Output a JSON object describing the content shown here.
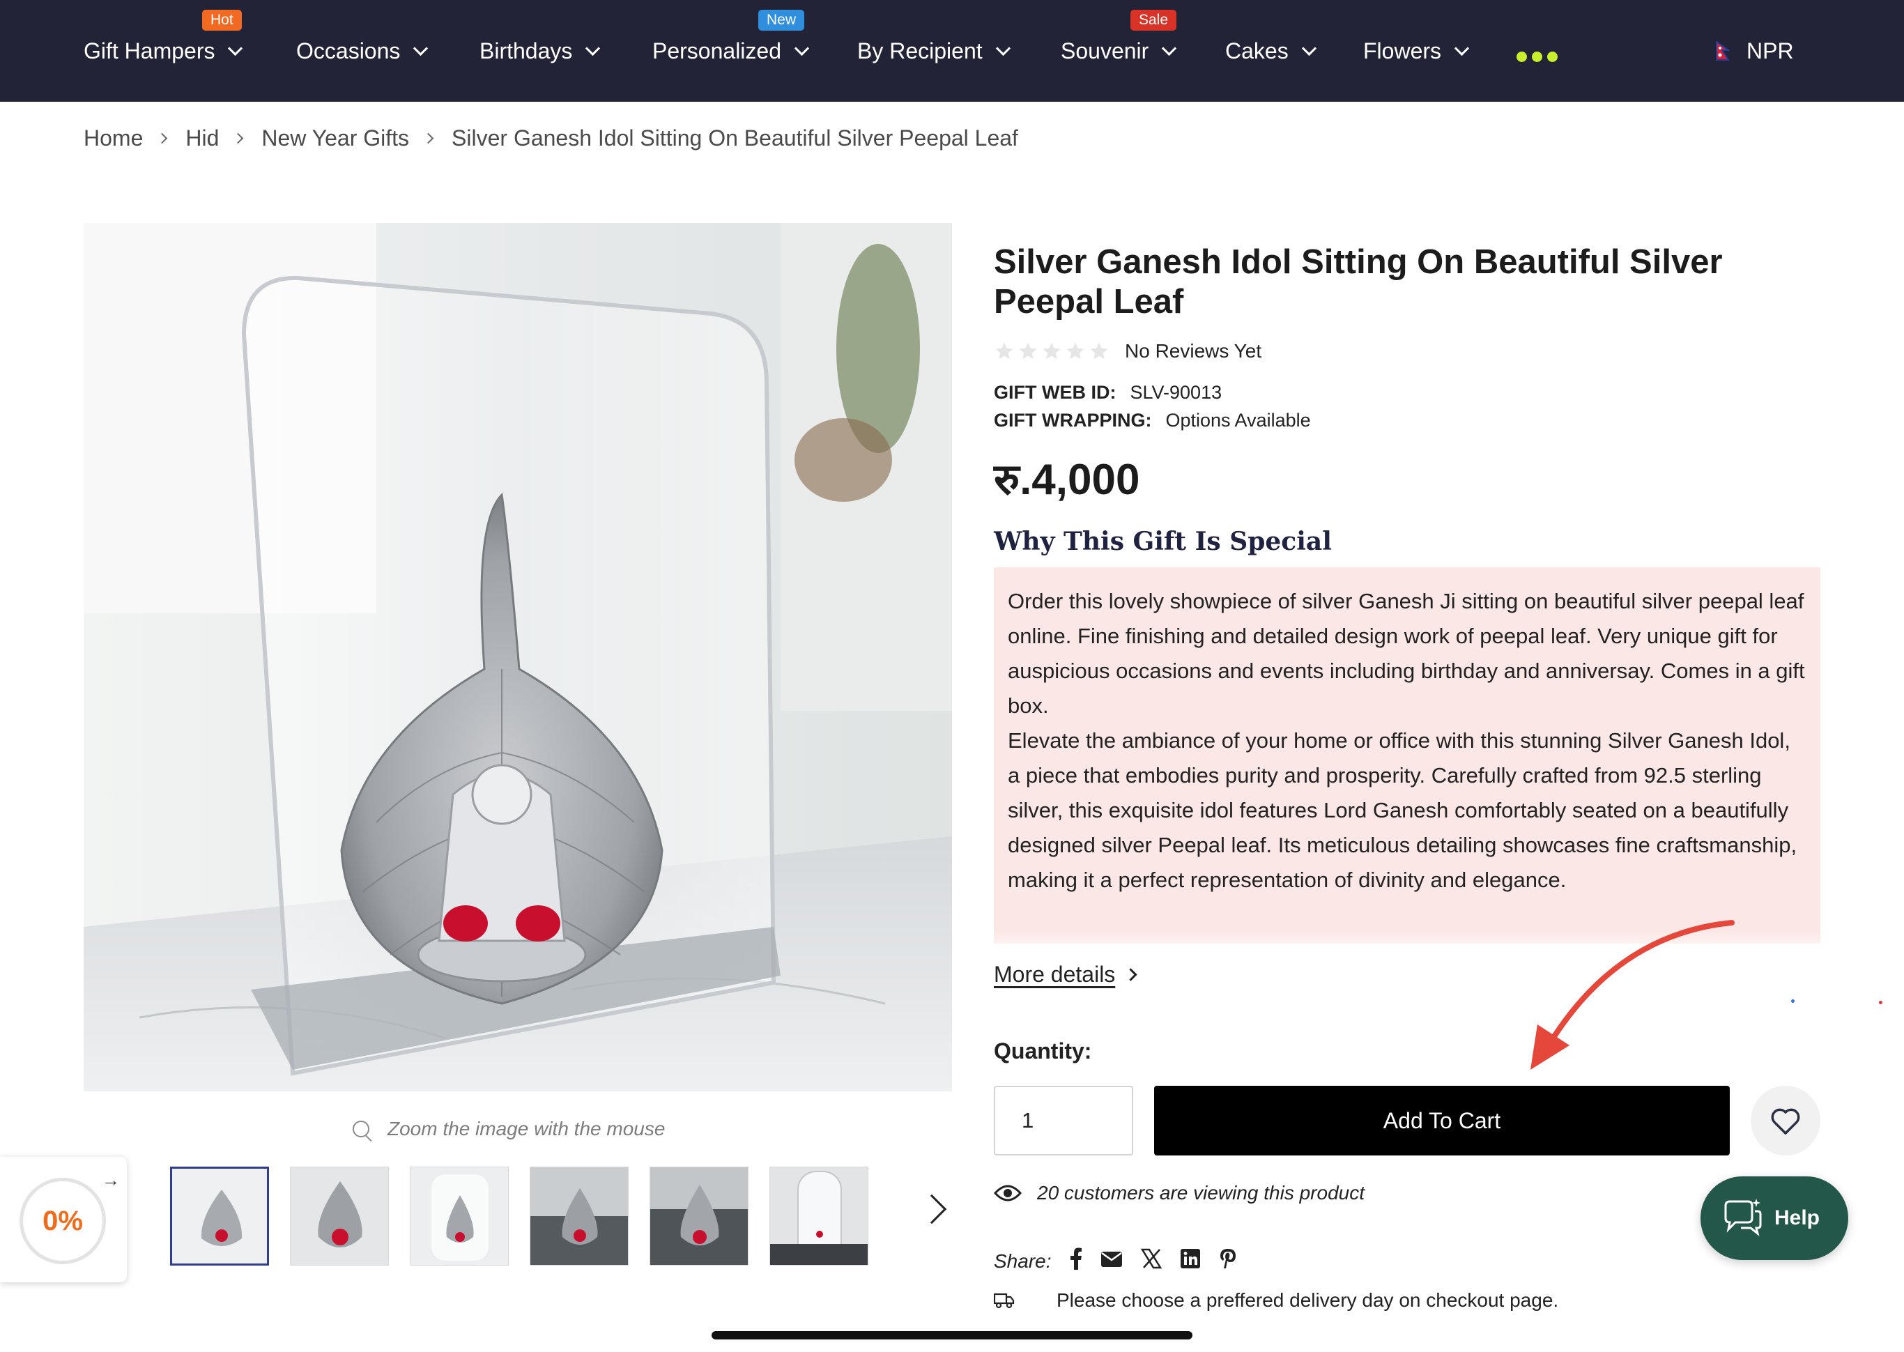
{
  "nav": {
    "items": [
      {
        "label": "Gift Hampers",
        "badge": "Hot",
        "badge_color": "#f26a21"
      },
      {
        "label": "Occasions"
      },
      {
        "label": "Birthdays"
      },
      {
        "label": "Personalized",
        "badge": "New",
        "badge_color": "#2f8fdd"
      },
      {
        "label": "By Recipient"
      },
      {
        "label": "Souvenir",
        "badge": "Sale",
        "badge_color": "#d93328"
      },
      {
        "label": "Cakes"
      },
      {
        "label": "Flowers"
      }
    ],
    "more_icon": "more-dots-icon",
    "more_color": "#c8ef2c",
    "currency": "NPR",
    "background": "#232338"
  },
  "breadcrumb": [
    "Home",
    "Hid",
    "New Year Gifts",
    "Silver Ganesh Idol Sitting On Beautiful Silver Peepal Leaf"
  ],
  "gallery": {
    "zoom_hint": "Zoom the image with the mouse",
    "thumbnail_count": 6,
    "active_thumbnail": 0
  },
  "promo": {
    "value": "0%"
  },
  "product": {
    "title": "Silver Ganesh Idol Sitting On Beautiful Silver Peepal Leaf",
    "rating_stars": 0,
    "rating_max": 5,
    "reviews_text": "No Reviews Yet",
    "gift_web_id_label": "GIFT WEB ID:",
    "gift_web_id": "SLV-90013",
    "gift_wrapping_label": "GIFT WRAPPING:",
    "gift_wrapping": "Options Available",
    "price": "रु.4,000",
    "special_heading": "Why This Gift Is Special",
    "description_1": "Order this lovely showpiece of silver Ganesh Ji sitting on beautiful silver peepal leaf online. Fine finishing and detailed design work of peepal leaf. Very unique gift for auspicious occasions and events including birthday and anniversay. Comes in a gift box.",
    "description_2": "Elevate the ambiance of your home or office with this stunning Silver Ganesh Idol, a piece that embodies purity and prosperity. Carefully crafted from 92.5 sterling silver, this exquisite idol features Lord Ganesh comfortably seated on a beautifully designed silver Peepal leaf. Its meticulous detailing showcases fine craftsmanship, making it a perfect representation of divinity and elegance.",
    "more_details": "More details",
    "quantity_label": "Quantity:",
    "quantity_value": "1",
    "add_to_cart": "Add To Cart",
    "viewers_text": "20 customers are viewing this product",
    "share_label": "Share:",
    "share_icons": [
      "facebook-icon",
      "email-icon",
      "x-icon",
      "linkedin-icon",
      "pinterest-icon"
    ],
    "delivery_text": "Please choose a preffered delivery day on checkout page."
  },
  "help": {
    "label": "Help",
    "color": "#23574a"
  },
  "colors": {
    "description_bg": "#fbe8e6",
    "annotation_arrow": "#e5483a",
    "cart_button": "#000000"
  }
}
